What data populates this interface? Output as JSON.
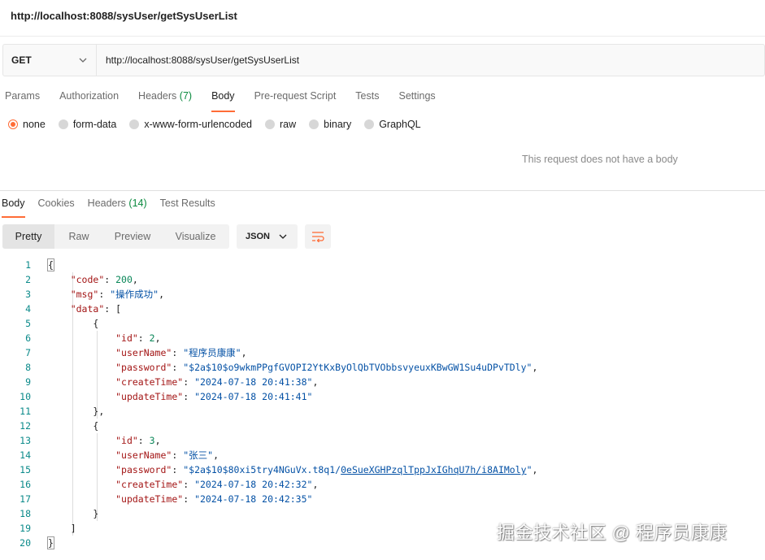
{
  "request": {
    "title": "http://localhost:8088/sysUser/getSysUserList",
    "method": "GET",
    "url": "http://localhost:8088/sysUser/getSysUserList"
  },
  "request_tabs": [
    {
      "label": "Params",
      "count": ""
    },
    {
      "label": "Authorization",
      "count": ""
    },
    {
      "label": "Headers",
      "count": "(7)"
    },
    {
      "label": "Body",
      "count": "",
      "active": true
    },
    {
      "label": "Pre-request Script",
      "count": ""
    },
    {
      "label": "Tests",
      "count": ""
    },
    {
      "label": "Settings",
      "count": ""
    }
  ],
  "body_options": [
    {
      "label": "none",
      "selected": true
    },
    {
      "label": "form-data",
      "selected": false
    },
    {
      "label": "x-www-form-urlencoded",
      "selected": false
    },
    {
      "label": "raw",
      "selected": false
    },
    {
      "label": "binary",
      "selected": false
    },
    {
      "label": "GraphQL",
      "selected": false
    }
  ],
  "no_body_text": "This request does not have a body",
  "response_tabs": [
    {
      "label": "Body",
      "count": "",
      "active": true
    },
    {
      "label": "Cookies",
      "count": ""
    },
    {
      "label": "Headers",
      "count": "(14)"
    },
    {
      "label": "Test Results",
      "count": ""
    }
  ],
  "view_modes": {
    "pretty": "Pretty",
    "raw": "Raw",
    "preview": "Preview",
    "visualize": "Visualize"
  },
  "format": "JSON",
  "json_lines": [
    "{",
    "    \"code\": 200,",
    "    \"msg\": \"操作成功\",",
    "    \"data\": [",
    "        {",
    "            \"id\": 2,",
    "            \"userName\": \"程序员康康\",",
    "            \"password\": \"$2a$10$o9wkmPPgfGVOPI2YtKxByOlQbTVObbsvyeuxKBwGW1Su4uDPvTDly\",",
    "            \"createTime\": \"2024-07-18 20:41:38\",",
    "            \"updateTime\": \"2024-07-18 20:41:41\"",
    "        },",
    "        {",
    "            \"id\": 3,",
    "            \"userName\": \"张三\",",
    "            \"password\": \"$2a$10$80xi5try4NGuVx.t8q1/0eSueXGHPzqlTppJxIGhqU7h/i8AIMoly\",",
    "            \"createTime\": \"2024-07-18 20:42:32\",",
    "            \"updateTime\": \"2024-07-18 20:42:35\"",
    "        }",
    "    ]",
    "}"
  ],
  "watermark": "掘金技术社区 @ 程序员康康",
  "colors": {
    "accent": "#ff6c37",
    "count_green": "#0b8a3f",
    "json_key": "#a31515",
    "json_string": "#0451a5",
    "json_number": "#098658"
  }
}
